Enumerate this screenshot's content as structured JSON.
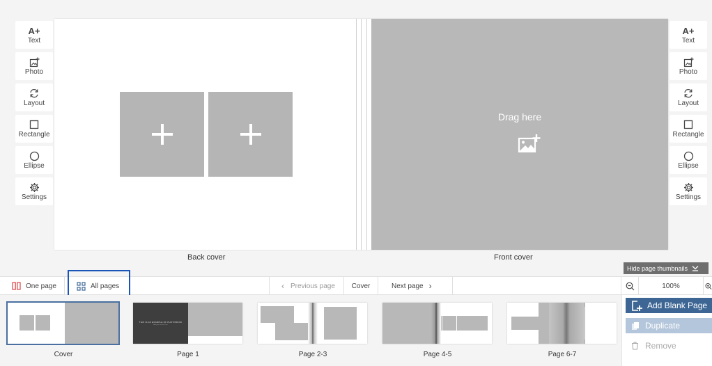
{
  "tools": [
    {
      "key": "text",
      "label": "Text",
      "icon": "text-size-icon",
      "glyph": "A+"
    },
    {
      "key": "photo",
      "label": "Photo",
      "icon": "add-photo-icon"
    },
    {
      "key": "layout",
      "label": "Layout",
      "icon": "refresh-layout-icon"
    },
    {
      "key": "rectangle",
      "label": "Rectangle",
      "icon": "rectangle-icon"
    },
    {
      "key": "ellipse",
      "label": "Ellipse",
      "icon": "ellipse-icon"
    },
    {
      "key": "settings",
      "label": "Settings",
      "icon": "gear-icon"
    }
  ],
  "canvas": {
    "back_cover_label": "Back cover",
    "front_cover_label": "Front cover",
    "drag_here": "Drag here"
  },
  "toolbar": {
    "one_page": "One page",
    "all_pages": "All pages",
    "previous_page": "Previous page",
    "current": "Cover",
    "next_page": "Next page",
    "zoom": "100%",
    "hide_thumbnails": "Hide page thumbnails"
  },
  "thumbnails": [
    {
      "label": "Cover",
      "selected": true
    },
    {
      "label": "Page 1",
      "title_text": "THIS IS AN EXAMPLE OF PHOTOBOOK",
      "subtitle_text": "Add your own text here"
    },
    {
      "label": "Page 2-3"
    },
    {
      "label": "Page 4-5"
    },
    {
      "label": "Page 6-7"
    }
  ],
  "panel": {
    "add_blank_page": "Add Blank Page",
    "duplicate": "Duplicate",
    "remove": "Remove"
  },
  "colors": {
    "accent": "#3d6695",
    "selection_outline": "#1a56b8",
    "placeholder": "#b8b8b8",
    "one_page_icon": "#e05050"
  }
}
